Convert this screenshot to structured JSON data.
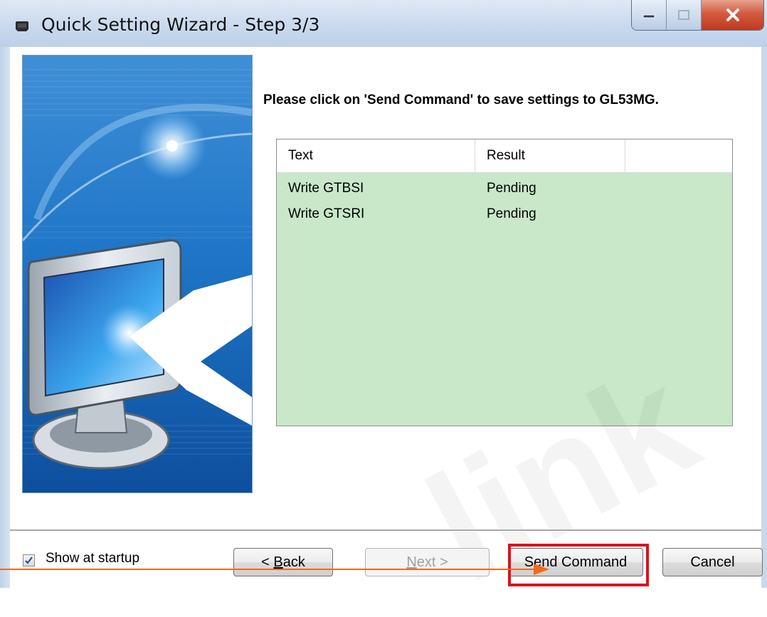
{
  "window": {
    "title": "Quick Setting Wizard - Step 3/3"
  },
  "instruction": "Please click on 'Send Command' to save settings to GL53MG.",
  "table": {
    "columns": [
      "Text",
      "Result",
      ""
    ],
    "rows": [
      {
        "text": "Write GTBSI",
        "result": "Pending"
      },
      {
        "text": "Write GTSRI",
        "result": "Pending"
      }
    ]
  },
  "footer": {
    "show_at_startup_label": "Show at startup",
    "show_at_startup_checked": true
  },
  "buttons": {
    "back": {
      "pre": "< ",
      "key": "B",
      "post": "ack"
    },
    "next": {
      "key": "N",
      "post": "ext >"
    },
    "send": {
      "pre": "S",
      "key": "e",
      "post": "nd Command"
    },
    "cancel": "Cancel"
  },
  "colors": {
    "table_background": "#c8e8c9",
    "highlight_box": "#e0101a",
    "annotation_arrow": "#f26a1b"
  }
}
